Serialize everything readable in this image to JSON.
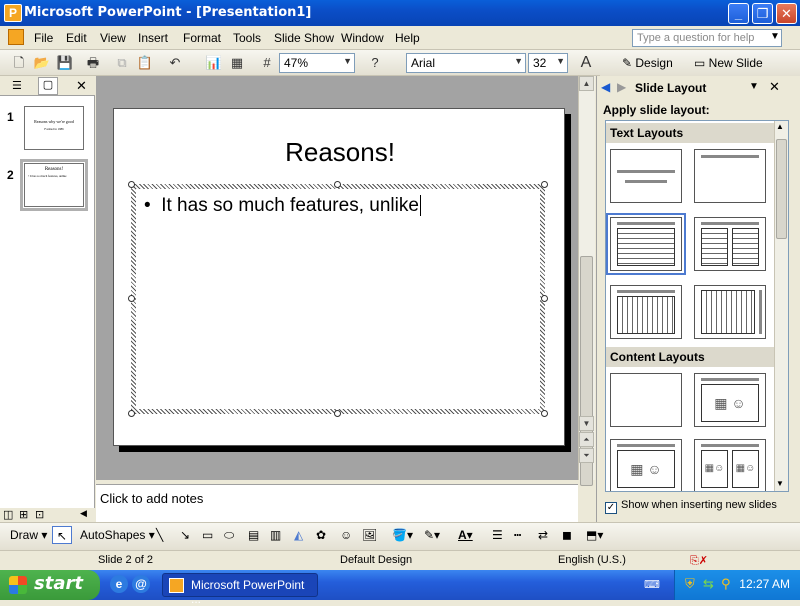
{
  "window": {
    "title": "Microsoft PowerPoint - [Presentation1]",
    "app_icon_letter": "P"
  },
  "menu": {
    "items": [
      "File",
      "Edit",
      "View",
      "Insert",
      "Format",
      "Tools",
      "Slide Show",
      "Window",
      "Help"
    ],
    "help_placeholder": "Type a question for help"
  },
  "toolbar": {
    "zoom": "47%",
    "font": "Arial",
    "font_size": "32",
    "design_label": "Design",
    "new_slide_label": "New Slide"
  },
  "left_pane": {
    "slide_numbers": [
      "1",
      "2"
    ],
    "thumb1_title": "Reasons why we're good",
    "thumb1_sub": "Formed in 1986",
    "thumb2_title": "Reasons!",
    "thumb2_text": "• It has so much features, unlike"
  },
  "slide": {
    "title": "Reasons!",
    "bullet": "It has so much features, unlike"
  },
  "notes": {
    "placeholder": "Click to add notes"
  },
  "task_pane": {
    "title": "Slide Layout",
    "subtitle": "Apply slide layout:",
    "section_text": "Text Layouts",
    "section_content": "Content Layouts",
    "checkbox_label": "Show when inserting new slides",
    "checkbox_checked": true
  },
  "drawing": {
    "draw_label": "Draw",
    "autoshapes_label": "AutoShapes"
  },
  "status": {
    "slide": "Slide 2 of 2",
    "design": "Default Design",
    "language": "English (U.S.)"
  },
  "taskbar": {
    "start_label": "start",
    "app_label": "Microsoft PowerPoint ...",
    "time": "12:27 AM"
  },
  "colors": {
    "titlebar": "#0b4ec7",
    "taskbar": "#245edb",
    "start": "#3a9a3a",
    "selection": "#4d7ad0"
  }
}
